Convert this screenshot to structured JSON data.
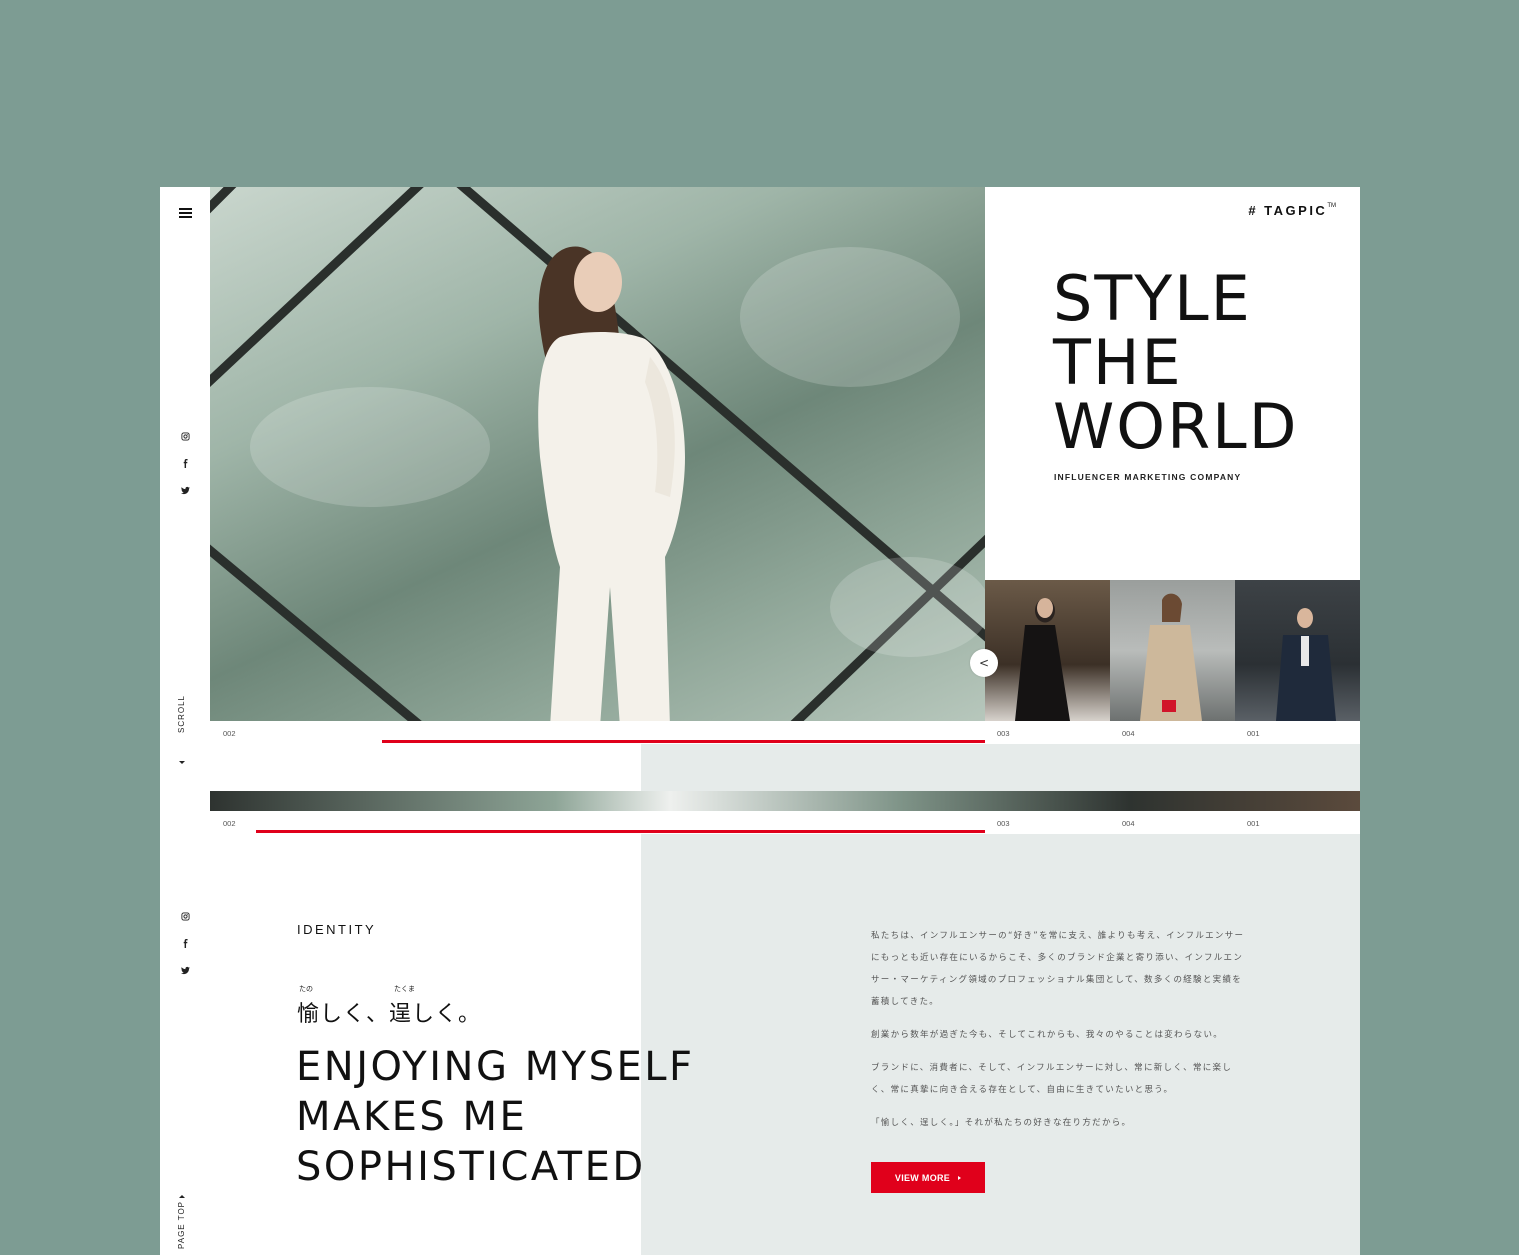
{
  "brand": {
    "logo": "# TAGPIC",
    "tm": "TM"
  },
  "hero": {
    "headline": [
      "STYLE",
      "THE",
      "WORLD"
    ],
    "tagline": "INFLUENCER MARKETING COMPANY"
  },
  "rail": {
    "scroll_label": "SCROLL",
    "pagetop_label": "PAGE TOP"
  },
  "slider": {
    "prev_label": "<",
    "numbers_top": {
      "current": "002",
      "thumbs": [
        "003",
        "004",
        "001"
      ]
    },
    "numbers_bottom": {
      "current": "002",
      "thumbs": [
        "003",
        "004",
        "001"
      ]
    }
  },
  "identity": {
    "label": "IDENTITY",
    "jp_title": "愉しく、逞しく。",
    "furigana": [
      "たの",
      "たくま"
    ],
    "en_title": [
      "ENJOYING MYSELF",
      "MAKES ME",
      "SOPHISTICATED"
    ],
    "paragraphs": [
      "私たちは、インフルエンサーの“好き”を常に支え、誰よりも考え、インフルエンサーにもっとも近い存在にいるからこそ、多くのブランド企業と寄り添い、インフルエンサー・マーケティング領域のプロフェッショナル集団として、数多くの経験と実績を蓄積してきた。",
      "創業から数年が過ぎた今も、そしてこれからも、我々のやることは変わらない。",
      "ブランドに、消費者に、そして、インフルエンサーに対し、常に新しく、常に楽しく、常に真摯に向き合える存在として、自由に生きていたいと思う。",
      "「愉しく、逞しく。」それが私たちの好きな在り方だから。"
    ],
    "view_more": "VIEW MORE"
  },
  "colors": {
    "background": "#7d9c93",
    "accent": "#e0001b",
    "gray_panel": "#e6ebea"
  }
}
